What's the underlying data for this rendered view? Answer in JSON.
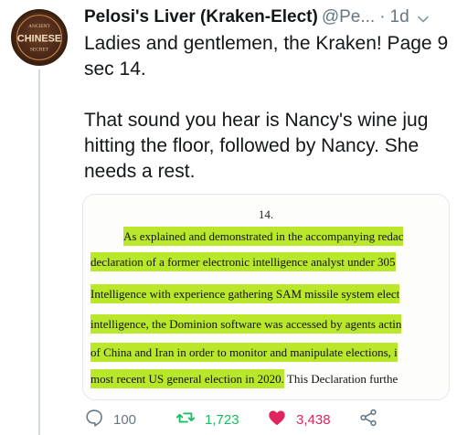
{
  "tweet": {
    "display_name": "Pelosi's Liver (Kraken-Elect)",
    "handle": "@Pe...",
    "separator": "·",
    "time": "1d",
    "text_paragraph_1": "Ladies and gentlemen, the Kraken! Page 9 sec 14.",
    "text_paragraph_2": "That sound you hear is Nancy's wine jug hitting the floor, followed by Nancy. She needs a rest."
  },
  "avatar": {
    "logo_text_top": "ANCIENT",
    "logo_text_main": "CHINESE",
    "logo_text_bottom": "SECRET"
  },
  "document": {
    "page_number": "14.",
    "lines": [
      {
        "highlighted": "As explained and demonstrated in the accompanying redac",
        "plain": ""
      },
      {
        "highlighted": "declaration of  a former electronic intelligence analyst under 305",
        "plain": ""
      },
      {
        "highlighted": "Intelligence with experience gathering SAM missile system elect",
        "plain": ""
      },
      {
        "highlighted": "intelligence, the Dominion software was accessed by agents actin",
        "plain": ""
      },
      {
        "highlighted": "of China and Iran in order to monitor and manipulate elections, i",
        "plain": ""
      },
      {
        "highlighted": "most recent US general election in 2020.",
        "plain": " This Declaration furthe"
      }
    ]
  },
  "actions": {
    "reply_count": "100",
    "retweet_count": "1,723",
    "like_count": "3,438"
  },
  "colors": {
    "highlight": "#b9e82b",
    "retweet": "#17bf63",
    "like": "#e0245e",
    "muted": "#657786"
  }
}
